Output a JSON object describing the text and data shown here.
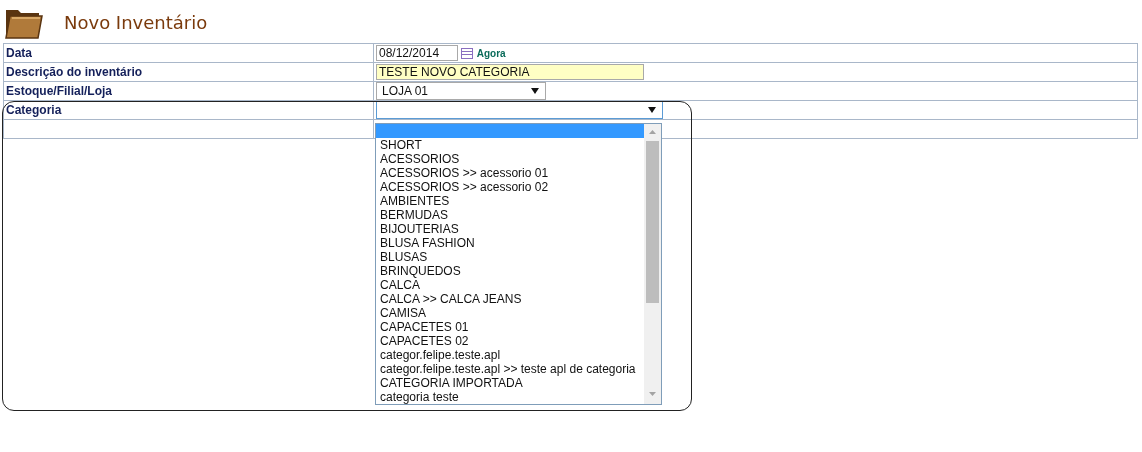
{
  "page": {
    "title": "Novo Inventário"
  },
  "fields": [
    {
      "kind": "date",
      "label": "Data",
      "value": "08/12/2014",
      "link": "Agora"
    },
    {
      "kind": "text",
      "label": "Descrição do inventário",
      "value": "TESTE NOVO CATEGORIA"
    },
    {
      "kind": "select",
      "label": "Estoque/Filial/Loja",
      "value": "LOJA 01",
      "expanded": false
    },
    {
      "kind": "select",
      "label": "Categoria",
      "expanded": true,
      "options": [
        {
          "selected": true
        },
        {
          "label": "SHORT",
          "selected": false
        },
        {
          "label": "ACESSORIOS",
          "selected": false
        },
        {
          "label": "ACESSORIOS >> acessorio 01",
          "selected": false
        },
        {
          "label": "ACESSORIOS >> acessorio 02",
          "selected": false
        },
        {
          "label": "AMBIENTES",
          "selected": false
        },
        {
          "label": "BERMUDAS",
          "selected": false
        },
        {
          "label": "BIJOUTERIAS",
          "selected": false
        },
        {
          "label": "BLUSA FASHION",
          "selected": false
        },
        {
          "label": "BLUSAS",
          "selected": false
        },
        {
          "label": "BRINQUEDOS",
          "selected": false
        },
        {
          "label": "CALCA",
          "selected": false
        },
        {
          "label": "CALCA >> CALCA JEANS",
          "selected": false
        },
        {
          "label": "CAMISA",
          "selected": false
        },
        {
          "label": "CAPACETES 01",
          "selected": false
        },
        {
          "label": "CAPACETES 02",
          "selected": false
        },
        {
          "label": "categor.felipe.teste.apl",
          "selected": false
        },
        {
          "label": "categor.felipe.teste.apl >> teste apl de categoria",
          "selected": false
        },
        {
          "label": "CATEGORIA IMPORTADA",
          "selected": false
        },
        {
          "label": "categoria teste",
          "selected": false
        }
      ]
    },
    {
      "kind": "empty"
    }
  ]
}
